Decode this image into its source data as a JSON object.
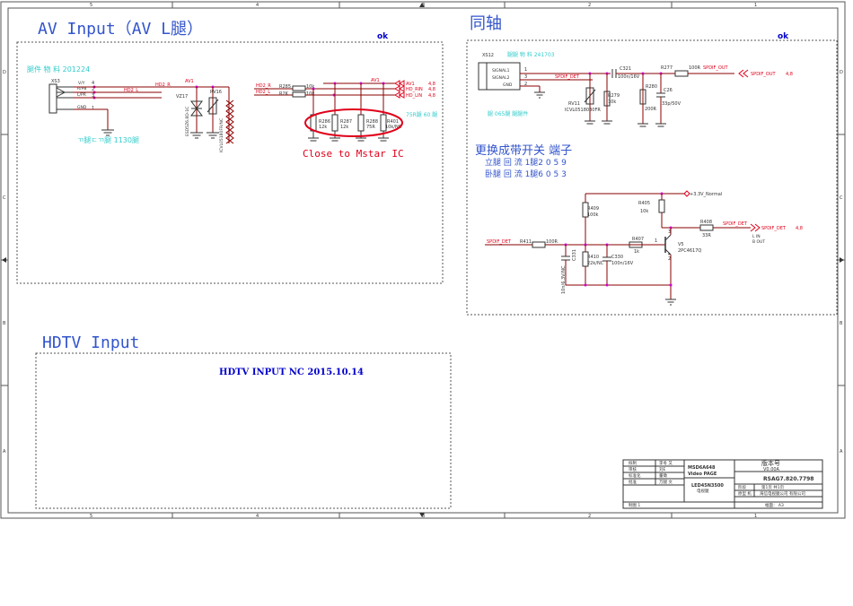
{
  "colors": {
    "wire": "#8b0000",
    "net_red": "#e0001a",
    "title_blue": "#0000cc",
    "cyan_note": "#33cccc",
    "junction": "#cc00cc",
    "box": "#555555"
  },
  "frame": {
    "col_marks": [
      "5",
      "4",
      "3",
      "2",
      "1"
    ],
    "row_marks": [
      "D",
      "C",
      "B",
      "A"
    ]
  },
  "av": {
    "title": "AV   Input（AV   L腿）",
    "ok": "ok",
    "note_part": "腿件 物 料 201224",
    "note_part2": "ㄲ腿ㄷㄲ腿 1130腿",
    "connector": {
      "ref": "XS3",
      "pins": [
        "4",
        "2",
        "3",
        "1"
      ],
      "pin_names": [
        "V/Y",
        "R/PB",
        "L/PR",
        "GND"
      ]
    },
    "nets": {
      "hd2r": "HD2_R",
      "hd2l": "HD2_L",
      "av1": "AV1"
    },
    "vz17": "VZ17",
    "vz17_part": "ESD5Z6.8D-1C",
    "rv16": "RV16",
    "rv16_part": "ICVL05180FR/NC",
    "right": {
      "hd2r": "HD2_R",
      "hd2l": "HD2_L",
      "r285": "R285",
      "r285v": "10k",
      "r286": "R2K",
      "r286v": "10k",
      "av1": "AV1",
      "out_av1": "AV1",
      "out_rin": "HD_RIN",
      "out_lin": "HD_LIN",
      "page1": "4,8",
      "page2": "4,8",
      "page3": "4,8",
      "note": "75R腿 60 腿",
      "resistors": [
        {
          "ref": "R286",
          "val": "12k"
        },
        {
          "ref": "R287",
          "val": "12k"
        },
        {
          "ref": "R288",
          "val": "75R"
        },
        {
          "ref": "R401",
          "val": "10k/NC"
        }
      ],
      "close_note": "Close to Mstar IC"
    }
  },
  "coax": {
    "title": "同轴",
    "ok": "ok",
    "xs12": "XS12",
    "note_part": "腿腿 物 料 241703",
    "sig_names": [
      "SIGNAL1",
      "SIGNAL2",
      "GND"
    ],
    "pins": [
      "1",
      "3",
      "2"
    ],
    "spdif_det": "SPDIF_DET",
    "c321": "C321",
    "c321v": "100n/16V",
    "r277": "R277",
    "r277v": "100R",
    "spdif_out": "SPDIF_OUT",
    "spdif_out_page": "4,8",
    "rv11": "RV11",
    "rv11v": "ICVL0518030FR",
    "r279": "R279",
    "r279v": "10k",
    "r280": "R280",
    "r280v": "200R",
    "c26": "C26",
    "c26v": "33p/50V",
    "note2": "腿 065腿 腿腿件"
  },
  "switch": {
    "title": "更换成带开关 端子",
    "line1": "立腿 回 流 1腿2 0 5 9",
    "line2": "卧腿 回 流 1腿6 0 5 3",
    "vcc": "+3.3V_Normal",
    "r405": "R405",
    "r405v": "10k",
    "r409": "R409",
    "r409v": "100k",
    "in_net": "SPDIF_DET",
    "r411": "R411",
    "r411v": "100R",
    "c331": "C331",
    "c331v": "10n/6.3V/NC",
    "r410": "R410",
    "r410v": "22k/NC",
    "c330": "C330",
    "c330v": "100n/16V",
    "r407": "R407",
    "r407v": "1k",
    "q": "V5",
    "qv": "2PC4617Q",
    "pin1": "1",
    "pin2": "2",
    "pin3": "3",
    "r408": "R408",
    "r408v": "33R",
    "out_net": "SPDIF_DET",
    "out_page": "4,8",
    "legend1": "L    IN",
    "legend2": "B    OUT"
  },
  "hdtv": {
    "title": "HDTV  Input",
    "note": "HDTV INPUT NC 2015.10.14"
  },
  "titleblock": {
    "rows_left": [
      [
        "拟制",
        "李冬 又"
      ],
      [
        "审核",
        "刘E"
      ],
      [
        "标准化",
        "董徵"
      ],
      [
        "批准",
        "万腿 文"
      ]
    ],
    "proj1": "MSD6A648",
    "proj2": "Video  PAGE",
    "board": "LED45N3500",
    "board2": "电视腿",
    "ver_label": "版本号",
    "ver": "V0.00A",
    "doc_no": "RSAG7.820.7798",
    "stage": "阶段",
    "page": "第1页 共1页",
    "company1": "原型 机",
    "company2": "海信电视腿公司 有限公司",
    "drawn": "制图 1",
    "size": "幅面： A3"
  }
}
